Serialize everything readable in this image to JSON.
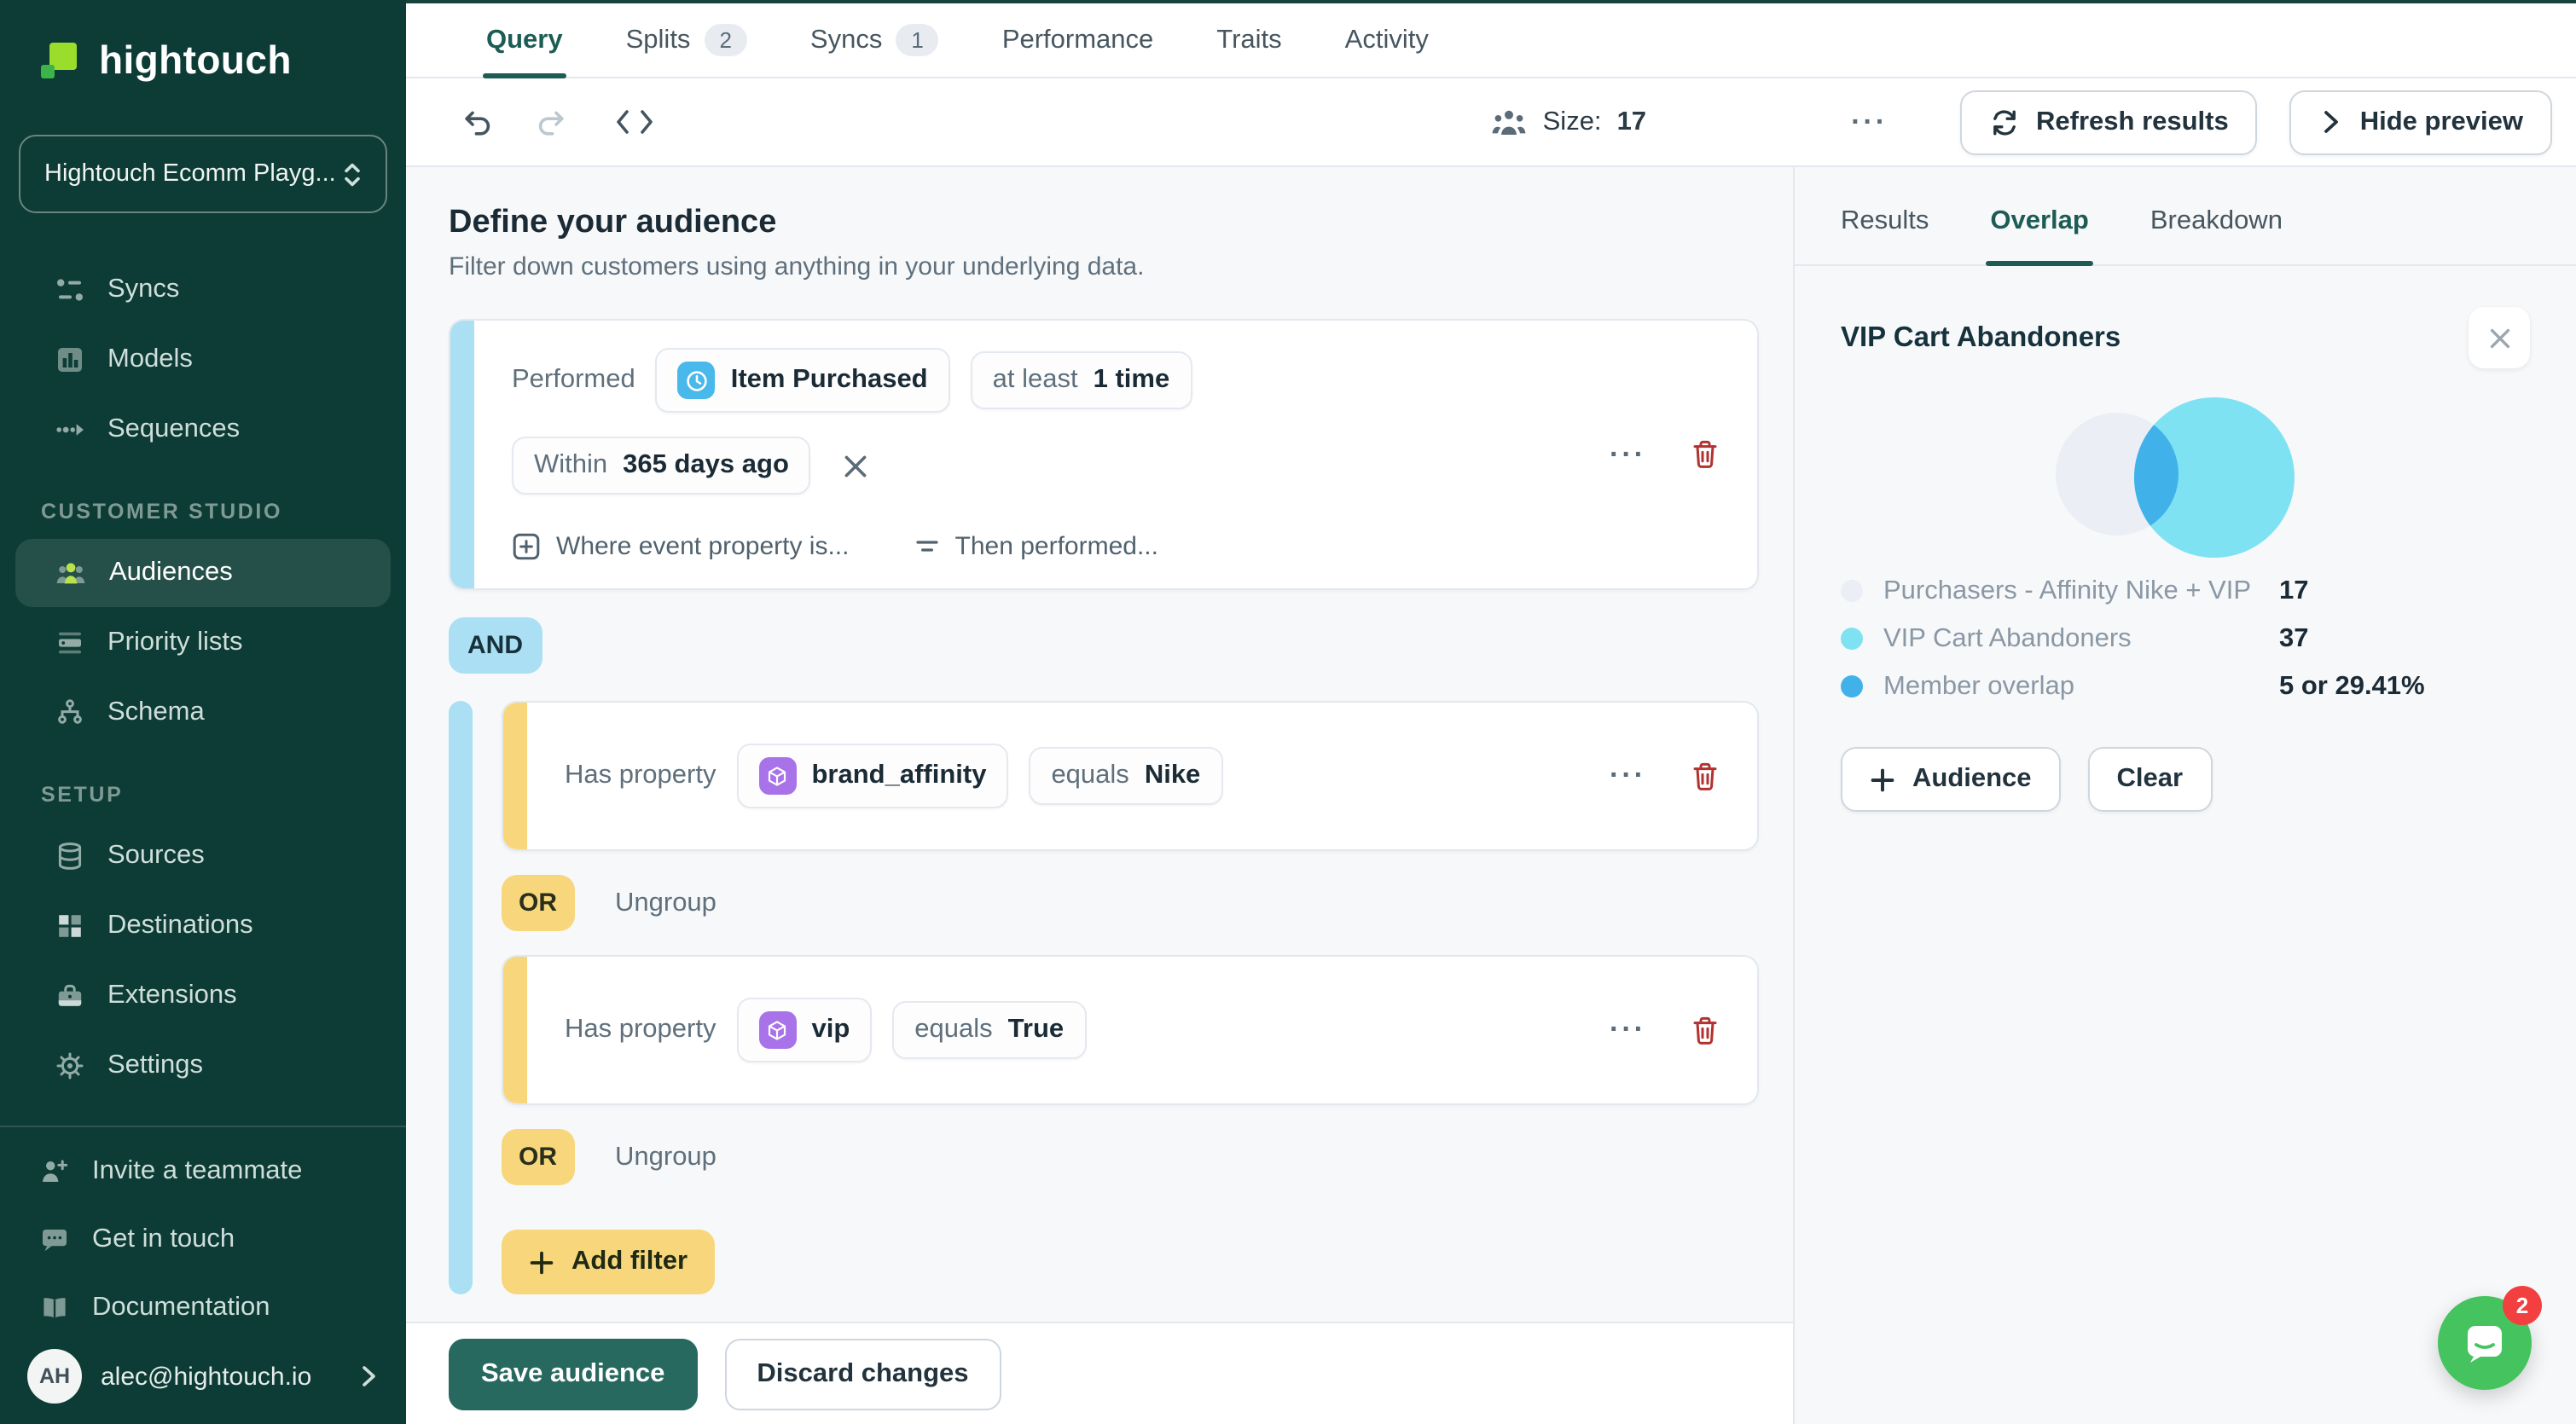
{
  "colors": {
    "sidebar-bg": "#0d3b35",
    "accent-blue": "#abdff3",
    "accent-yellow": "#f8d77c",
    "teal": "#1d5c55",
    "save-teal": "#27695f",
    "chip-blue": "#49b8ea",
    "chip-purple": "#a873e8",
    "danger": "#b23230",
    "venn-left": "#eceef6",
    "venn-right": "#7fe2f3",
    "venn-overlap": "#41b2e9",
    "intercom-green": "#45c35f",
    "badge-red": "#f23f3f",
    "lime": "#9ade2b"
  },
  "sidebar": {
    "logo_text": "hightouch",
    "workspace": "Hightouch Ecomm Playg...",
    "nav": [
      {
        "label": "Syncs"
      },
      {
        "label": "Models"
      },
      {
        "label": "Sequences"
      }
    ],
    "customer_studio_header": "CUSTOMER STUDIO",
    "customer_studio": [
      {
        "label": "Audiences"
      },
      {
        "label": "Priority lists"
      },
      {
        "label": "Schema"
      }
    ],
    "setup_header": "SETUP",
    "setup": [
      {
        "label": "Sources"
      },
      {
        "label": "Destinations"
      },
      {
        "label": "Extensions"
      },
      {
        "label": "Settings"
      }
    ],
    "footer": [
      {
        "label": "Invite a teammate"
      },
      {
        "label": "Get in touch"
      },
      {
        "label": "Documentation"
      }
    ],
    "account": {
      "initials": "AH",
      "email": "alec@hightouch.io"
    }
  },
  "tabs": {
    "query": "Query",
    "splits": "Splits",
    "splits_badge": "2",
    "syncs": "Syncs",
    "syncs_badge": "1",
    "performance": "Performance",
    "traits": "Traits",
    "activity": "Activity"
  },
  "toolbar": {
    "size_label": "Size:",
    "size_value": "17",
    "more": "···",
    "refresh": "Refresh results",
    "hide": "Hide preview"
  },
  "builder": {
    "title": "Define your audience",
    "subtitle": "Filter down customers using anything in your underlying data.",
    "event": {
      "prefix": "Performed",
      "name": "Item Purchased",
      "freq_prefix": "at least",
      "freq": "1 time",
      "window_prefix": "Within",
      "window": "365 days ago",
      "add_property": "Where event property is...",
      "then_performed": "Then performed..."
    },
    "and": "AND",
    "or": "OR",
    "ungroup": "Ungroup",
    "cond1": {
      "prefix": "Has property",
      "property": "brand_affinity",
      "op": "equals",
      "value": "Nike"
    },
    "cond2": {
      "prefix": "Has property",
      "property": "vip",
      "op": "equals",
      "value": "True"
    },
    "add_filter": "Add filter",
    "save": "Save audience",
    "discard": "Discard changes"
  },
  "preview": {
    "tab_results": "Results",
    "tab_overlap": "Overlap",
    "tab_breakdown": "Breakdown",
    "title": "VIP Cart Abandoners",
    "legend": [
      {
        "label": "Purchasers - Affinity Nike + VIP",
        "value": "17"
      },
      {
        "label": "VIP Cart Abandoners",
        "value": "37"
      },
      {
        "label": "Member overlap",
        "value": "5 or 29.41%"
      }
    ],
    "venn": {
      "left_set": "Purchasers - Affinity Nike + VIP",
      "left_size": 17,
      "right_set": "VIP Cart Abandoners",
      "right_size": 37,
      "overlap_size": 5,
      "overlap_pct": "29.41%"
    },
    "audience_btn": "Audience",
    "clear_btn": "Clear"
  },
  "chat": {
    "badge": "2"
  }
}
